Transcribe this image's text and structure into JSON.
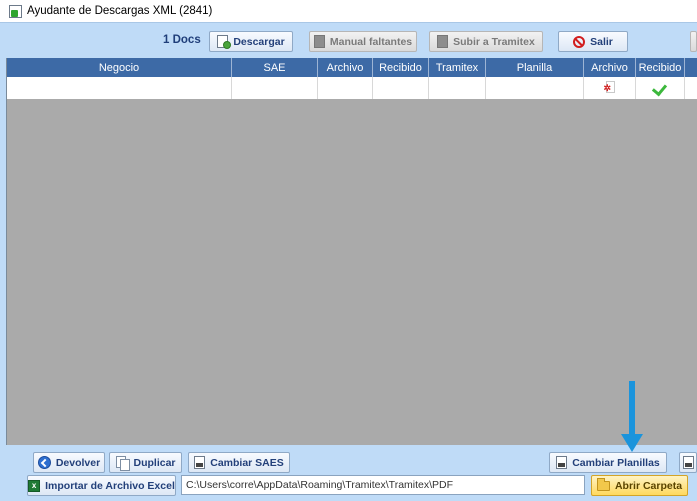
{
  "window": {
    "title": "Ayudante de Descargas XML (2841)"
  },
  "toolbar": {
    "docs_count": "1 Docs",
    "descargar": "Descargar",
    "manual_faltantes": "Manual faltantes",
    "subir_tramitex": "Subir a Tramitex",
    "salir": "Salir"
  },
  "grid": {
    "columns": [
      "Negocio",
      "SAE",
      "Archivo",
      "Recibido",
      "Tramitex",
      "Planilla",
      "Archivo",
      "Recibido"
    ],
    "rows": [
      {
        "negocio": "",
        "sae": "",
        "archivo": "",
        "recibido": "",
        "tramitex": "",
        "planilla": "",
        "archivo_icon": "pdf-icon",
        "recibido_icon": "checkmark-icon"
      }
    ]
  },
  "bottom": {
    "devolver": "Devolver",
    "duplicar": "Duplicar",
    "cambiar_saes": "Cambiar SAES",
    "cambiar_planillas": "Cambiar Planillas",
    "importar_excel": "Importar de Archivo Excel",
    "path_value": "C:\\Users\\corre\\AppData\\Roaming\\Tramitex\\Tramitex\\PDF",
    "abrir_carpeta": "Abrir Carpeta"
  },
  "colors": {
    "header_bg": "#3d6aa6",
    "client_bg": "#bfdbf7",
    "grid_empty": "#aaaaaa",
    "arrow": "#1b94dc",
    "highlight_button": "#ffd95e"
  }
}
